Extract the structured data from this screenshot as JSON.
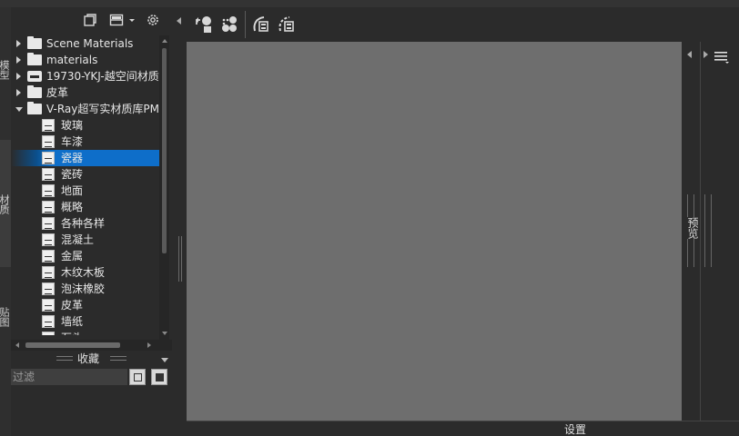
{
  "tabs": {
    "top": "模型",
    "middle": "材质",
    "bottom": "贴图"
  },
  "tree": {
    "items": [
      {
        "label": "Scene Materials",
        "kind": "folder",
        "expanded": false
      },
      {
        "label": "materials",
        "kind": "folder",
        "expanded": false
      },
      {
        "label": "19730-YKJ-越空间材质",
        "kind": "printer",
        "expanded": false
      },
      {
        "label": "皮革",
        "kind": "folder",
        "expanded": false
      },
      {
        "label": "V-Ray超写实材质库PM",
        "kind": "folder",
        "expanded": true
      }
    ],
    "children": [
      {
        "label": "玻璃"
      },
      {
        "label": "车漆"
      },
      {
        "label": "瓷器",
        "selected": true
      },
      {
        "label": "瓷砖"
      },
      {
        "label": "地面"
      },
      {
        "label": "概略"
      },
      {
        "label": "各种各样"
      },
      {
        "label": "混凝土"
      },
      {
        "label": "金属"
      },
      {
        "label": "木纹木板"
      },
      {
        "label": "泡沫橡胶"
      },
      {
        "label": "皮革"
      },
      {
        "label": "墙纸"
      },
      {
        "label": "石头"
      }
    ]
  },
  "favorites": {
    "title": "收藏"
  },
  "filter": {
    "placeholder": "过滤"
  },
  "right_panel": {
    "label": "预览"
  },
  "bottom": {
    "settings_label": "设置"
  },
  "colors": {
    "selection": "#0e6ec9",
    "canvas": "#6e6e6e",
    "panel": "#2b2b2b"
  },
  "icons": {
    "panel_toolbar": [
      "new-folder-icon",
      "layout-icon",
      "dropdown-arrow-icon",
      "settings-gear-icon"
    ],
    "main_toolbar": [
      "import-material-icon",
      "render-preview-icon",
      "add-material-icon",
      "delete-material-icon"
    ]
  }
}
